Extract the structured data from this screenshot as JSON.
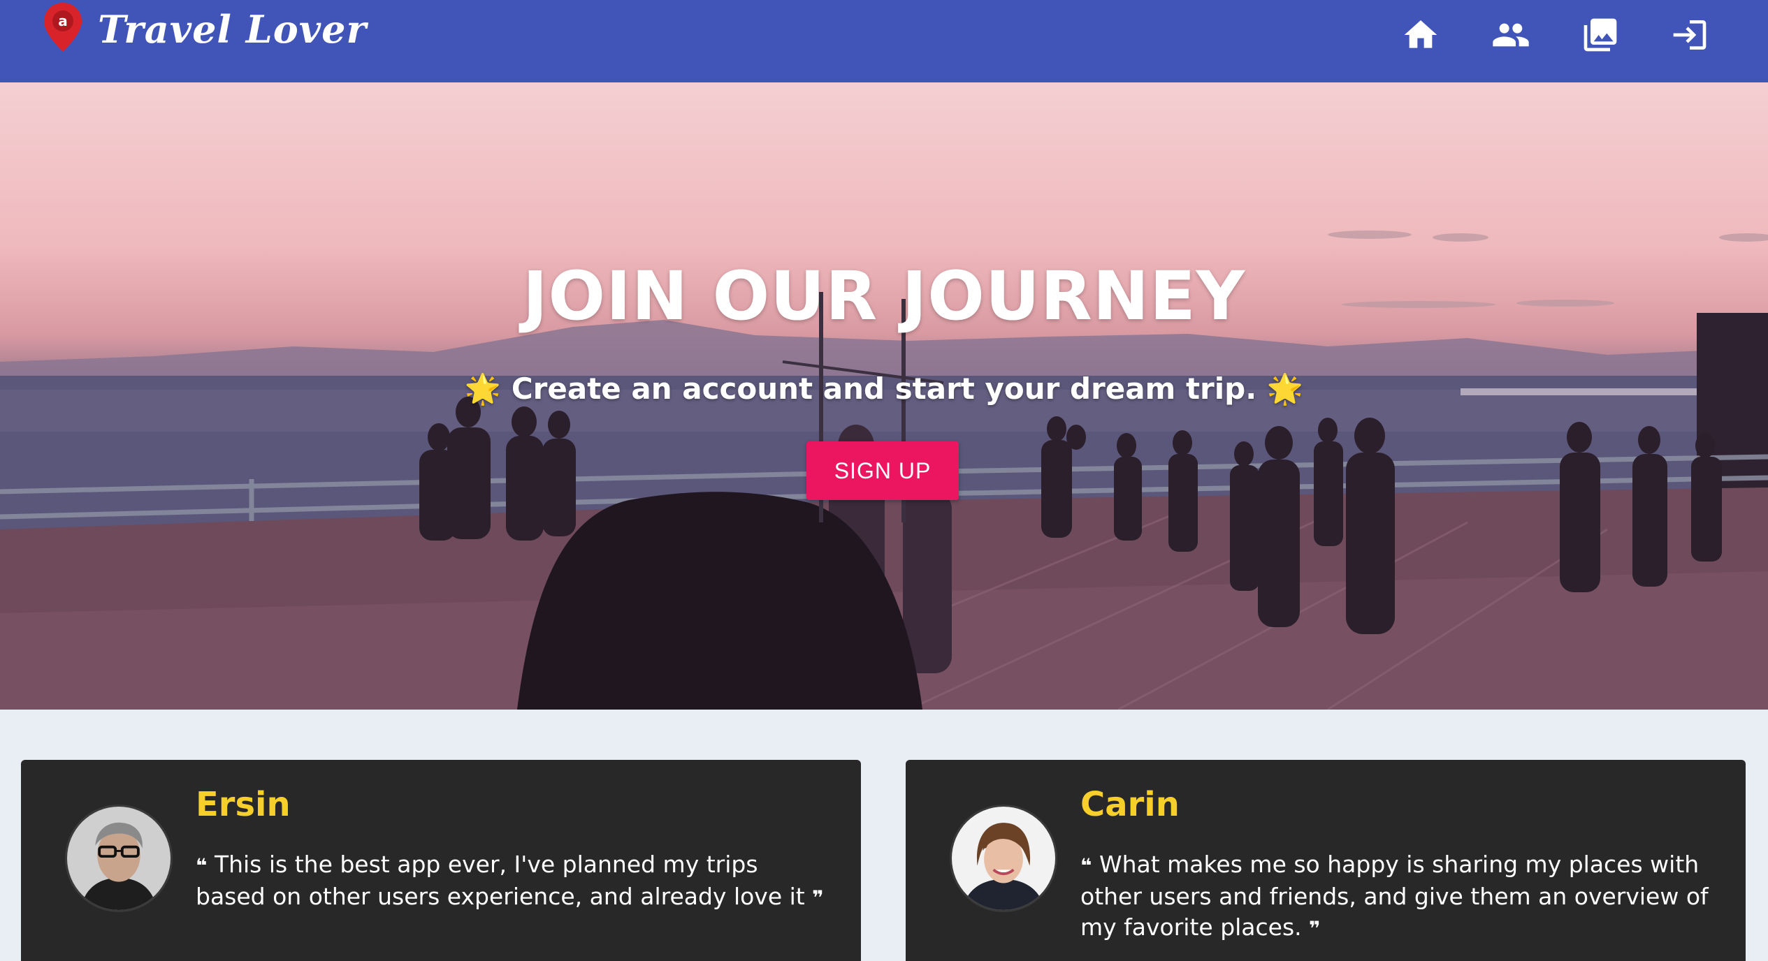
{
  "header": {
    "brand": "Travel Lover",
    "nav": [
      {
        "icon": "home-icon"
      },
      {
        "icon": "people-icon"
      },
      {
        "icon": "gallery-icon"
      },
      {
        "icon": "login-icon"
      }
    ],
    "colors": {
      "bar": "#4154b8",
      "pin": "#d8232a"
    }
  },
  "hero": {
    "title": "JOIN OUR JOURNEY",
    "subtitle": "Create an account and start your dream trip.",
    "star_glyph": "🌟",
    "signup_label": "SIGN UP",
    "colors": {
      "button": "#ec1560"
    }
  },
  "testimonials": [
    {
      "name": "Ersin",
      "quote": "This is the best app ever, I've planned my trips based on other users experience, and already love it",
      "open_quote": "❝",
      "close_quote": "❞"
    },
    {
      "name": "Carin",
      "quote": "What makes me so happy is sharing my places with other users and friends, and give them an overview of my favorite places.",
      "open_quote": "❝",
      "close_quote": "❞"
    }
  ],
  "colors": {
    "card": "#282828",
    "name": "#f6cf2a",
    "page": "#e9eef5"
  }
}
